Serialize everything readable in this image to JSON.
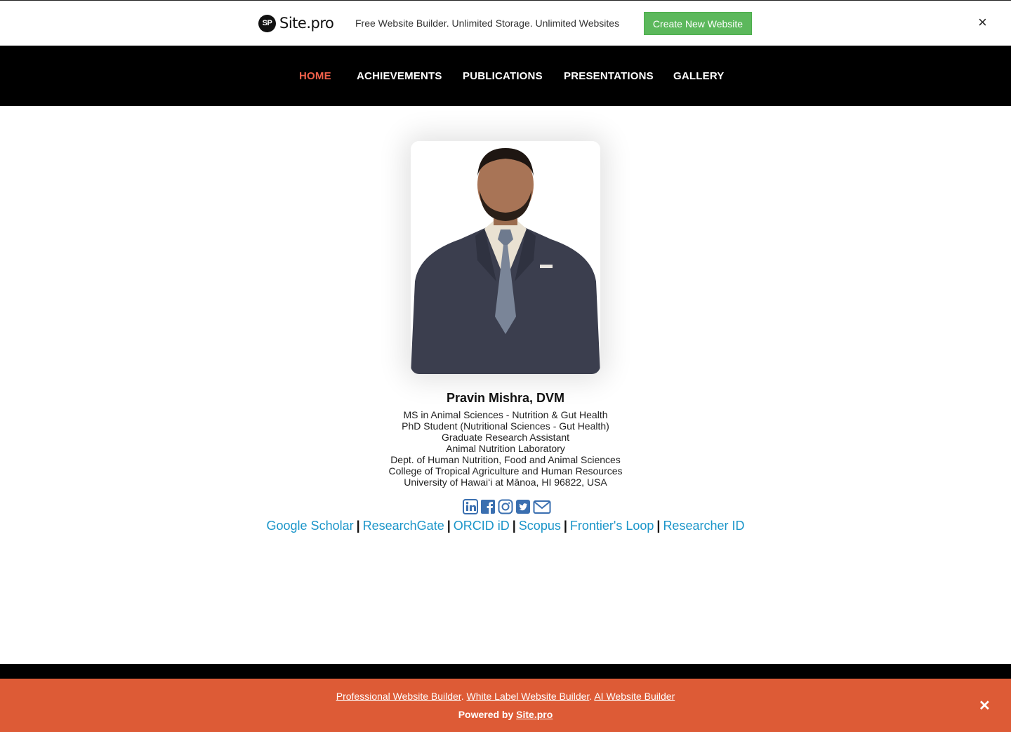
{
  "promo": {
    "logo_badge": "SP",
    "logo_name": "Site.pro",
    "tagline": "Free Website Builder. Unlimited Storage. Unlimited Websites",
    "cta_label": "Create New Website",
    "close": "×"
  },
  "nav": {
    "items": [
      {
        "label": "HOME",
        "active": true
      },
      {
        "label": "ACHIEVEMENTS"
      },
      {
        "label": "PUBLICATIONS"
      },
      {
        "label": "PRESENTATIONS"
      },
      {
        "label": "GALLERY"
      }
    ]
  },
  "profile": {
    "name": "Pravin Mishra, DVM",
    "bio": [
      "MS in Animal Sciences - Nutrition & Gut Health",
      "PhD Student (Nutritional Sciences - Gut Health)",
      "Graduate Research Assistant",
      "Animal Nutrition Laboratory",
      "Dept. of Human Nutrition, Food and Animal Sciences",
      "College of Tropical Agriculture and Human Resources",
      "University of Hawaiʻi at Mānoa, HI 96822, USA"
    ],
    "social_icons": [
      "linkedin-icon",
      "facebook-icon",
      "instagram-icon",
      "twitter-icon",
      "email-icon"
    ],
    "links": [
      "Google Scholar",
      "ResearchGate",
      "ORCID iD",
      "Scopus",
      "Frontier's Loop",
      "Researcher ID"
    ],
    "separator": "|"
  },
  "footer": {
    "link1": "Professional Website Builder",
    "link2": "White Label Website Builder",
    "link3": "AI Website Builder",
    "dot": ".",
    "powered_by": "Powered by",
    "site_link": "Site.pro",
    "close": "✕"
  },
  "colors": {
    "nav_active": "#f0604a",
    "link": "#1a95c9",
    "cta": "#5cb85c",
    "footer": "#dd5b36",
    "icon_blue": "#3a6fb0"
  }
}
